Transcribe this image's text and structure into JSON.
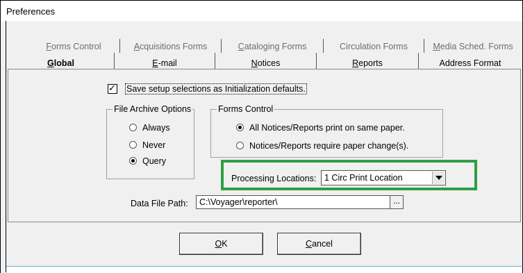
{
  "window": {
    "title": "Preferences"
  },
  "tabs": {
    "back_row": [
      {
        "accel": "F",
        "rest": "orms Control"
      },
      {
        "accel": "A",
        "rest": "cquisitions Forms"
      },
      {
        "accel": "C",
        "rest": "ataloging Forms"
      },
      {
        "accel": "",
        "rest": "Circulation Forms"
      },
      {
        "accel": "M",
        "rest": "edia Sched. Forms"
      }
    ],
    "front_row": [
      {
        "accel": "G",
        "rest": "lobal",
        "active": true
      },
      {
        "accel": "E",
        "rest": "-mail",
        "active": false
      },
      {
        "accel": "N",
        "rest": "otices",
        "active": false
      },
      {
        "accel": "R",
        "rest": "eports",
        "active": false
      },
      {
        "accel": "",
        "rest": "Address Format",
        "active": false
      }
    ]
  },
  "global": {
    "save_setup": {
      "label": "Save setup selections as Initialization defaults.",
      "checked": true
    },
    "file_archive": {
      "title": "File Archive Options",
      "options": [
        {
          "label": "Always",
          "selected": false
        },
        {
          "label": "Never",
          "selected": false
        },
        {
          "label": "Query",
          "selected": true
        }
      ]
    },
    "forms_control": {
      "title": "Forms Control",
      "options": [
        {
          "label": "All Notices/Reports print on same paper.",
          "selected": true
        },
        {
          "label": "Notices/Reports require paper change(s).",
          "selected": false
        }
      ]
    },
    "processing_locations": {
      "label": "Processing Locations:",
      "value": "1 Circ Print Location"
    },
    "data_file_path": {
      "label": "Data File Path:",
      "value": "C:\\Voyager\\reporter\\",
      "browse_label": "..."
    }
  },
  "buttons": {
    "ok": {
      "accel": "O",
      "rest": "K"
    },
    "cancel": {
      "accel": "C",
      "rest": "ancel"
    }
  },
  "colors": {
    "highlight": "#2f9e44",
    "background": "#f0f0f0"
  }
}
